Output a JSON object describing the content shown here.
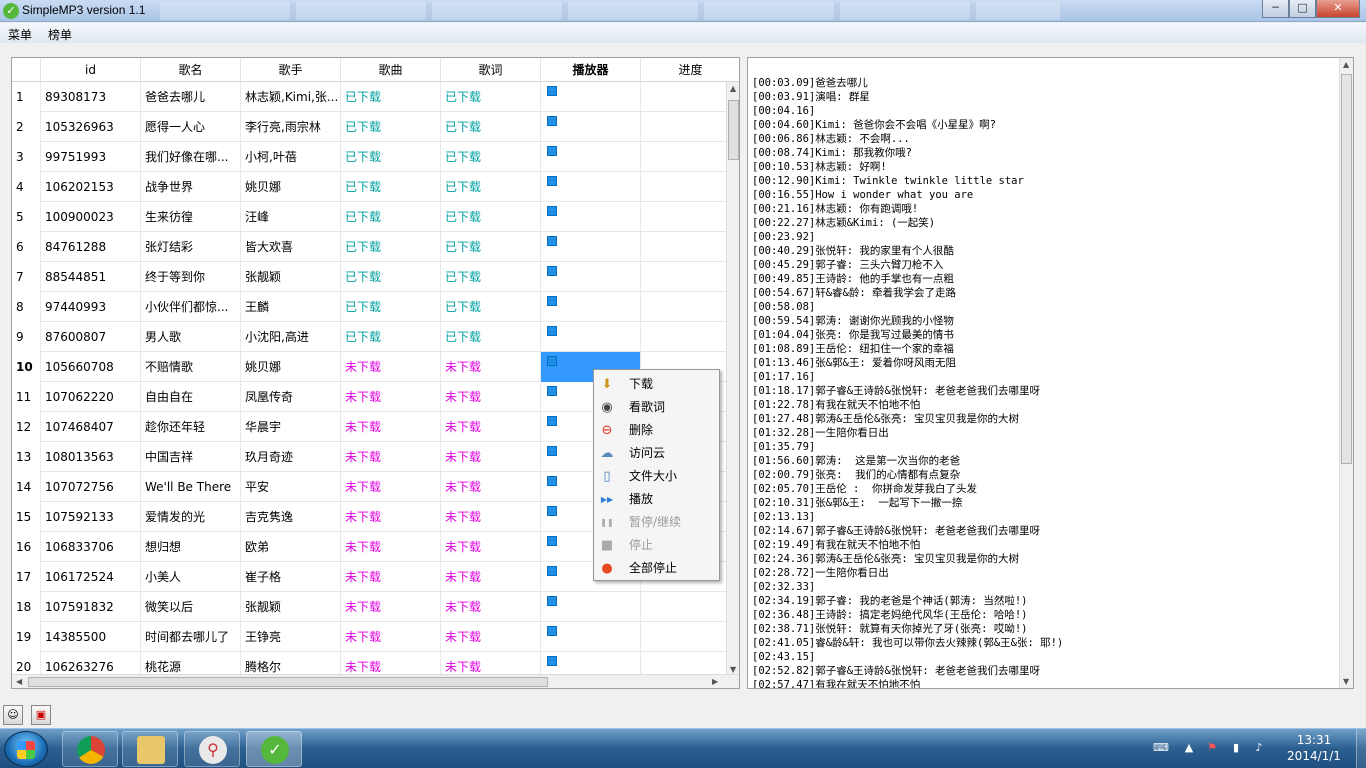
{
  "window": {
    "title": "SimpleMP3 version 1.1"
  },
  "menubar": {
    "items": [
      "菜单",
      "榜单"
    ]
  },
  "table": {
    "columns": [
      "id",
      "歌名",
      "歌手",
      "歌曲",
      "歌词",
      "播放器",
      "进度"
    ],
    "rows": [
      {
        "num": "1",
        "id": "89308173",
        "song": "爸爸去哪儿",
        "artist": "林志颖,Kimi,张...",
        "music": "已下载",
        "lyric": "已下载"
      },
      {
        "num": "2",
        "id": "105326963",
        "song": "愿得一人心",
        "artist": "李行亮,雨宗林",
        "music": "已下载",
        "lyric": "已下载"
      },
      {
        "num": "3",
        "id": "99751993",
        "song": "我们好像在哪...",
        "artist": "小柯,叶蓓",
        "music": "已下载",
        "lyric": "已下载"
      },
      {
        "num": "4",
        "id": "106202153",
        "song": "战争世界",
        "artist": "姚贝娜",
        "music": "已下载",
        "lyric": "已下载"
      },
      {
        "num": "5",
        "id": "100900023",
        "song": "生来彷徨",
        "artist": "汪峰",
        "music": "已下载",
        "lyric": "已下载"
      },
      {
        "num": "6",
        "id": "84761288",
        "song": "张灯结彩",
        "artist": "皆大欢喜",
        "music": "已下载",
        "lyric": "已下载"
      },
      {
        "num": "7",
        "id": "88544851",
        "song": "终于等到你",
        "artist": "张靓颖",
        "music": "已下载",
        "lyric": "已下载"
      },
      {
        "num": "8",
        "id": "97440993",
        "song": "小伙伴们都惊...",
        "artist": "王麟",
        "music": "已下载",
        "lyric": "已下载"
      },
      {
        "num": "9",
        "id": "87600807",
        "song": "男人歌",
        "artist": "小沈阳,高进",
        "music": "已下载",
        "lyric": "已下载"
      },
      {
        "num": "10",
        "id": "105660708",
        "song": "不赔情歌",
        "artist": "姚贝娜",
        "music": "未下载",
        "lyric": "未下载"
      },
      {
        "num": "11",
        "id": "107062220",
        "song": "自由自在",
        "artist": "凤凰传奇",
        "music": "未下载",
        "lyric": "未下载"
      },
      {
        "num": "12",
        "id": "107468407",
        "song": "趁你还年轻",
        "artist": "华晨宇",
        "music": "未下载",
        "lyric": "未下载"
      },
      {
        "num": "13",
        "id": "108013563",
        "song": "中国吉祥",
        "artist": "玖月奇迹",
        "music": "未下载",
        "lyric": "未下载"
      },
      {
        "num": "14",
        "id": "107072756",
        "song": "We'll Be There",
        "artist": "平安",
        "music": "未下载",
        "lyric": "未下载"
      },
      {
        "num": "15",
        "id": "107592133",
        "song": "爱情发的光",
        "artist": "吉克隽逸",
        "music": "未下载",
        "lyric": "未下载"
      },
      {
        "num": "16",
        "id": "106833706",
        "song": "想归想",
        "artist": "欧弟",
        "music": "未下载",
        "lyric": "未下载"
      },
      {
        "num": "17",
        "id": "106172524",
        "song": "小美人",
        "artist": "崔子格",
        "music": "未下载",
        "lyric": "未下载"
      },
      {
        "num": "18",
        "id": "107591832",
        "song": "微笑以后",
        "artist": "张靓颖",
        "music": "未下载",
        "lyric": "未下载"
      },
      {
        "num": "19",
        "id": "14385500",
        "song": "时间都去哪儿了",
        "artist": "王铮亮",
        "music": "未下载",
        "lyric": "未下载"
      },
      {
        "num": "20",
        "id": "106263276",
        "song": "桃花源",
        "artist": "腾格尔",
        "music": "未下载",
        "lyric": "未下载"
      }
    ],
    "selected_row": "10"
  },
  "context_menu": {
    "items": [
      {
        "label": "下载",
        "icon": "download-icon",
        "disabled": false
      },
      {
        "label": "看歌词",
        "icon": "eye-icon",
        "disabled": false
      },
      {
        "label": "删除",
        "icon": "delete-icon",
        "disabled": false
      },
      {
        "label": "访问云",
        "icon": "cloud-icon",
        "disabled": false
      },
      {
        "label": "文件大小",
        "icon": "clipboard-icon",
        "disabled": false
      },
      {
        "label": "播放",
        "icon": "play-icon",
        "disabled": false
      },
      {
        "label": "暂停/继续",
        "icon": "pause-icon",
        "disabled": true
      },
      {
        "label": "停止",
        "icon": "stop-icon",
        "disabled": true
      },
      {
        "label": "全部停止",
        "icon": "stop-all-icon",
        "disabled": false
      }
    ]
  },
  "lyrics": [
    "[00:03.09]爸爸去哪儿",
    "[00:03.91]演唱: 群星",
    "[00:04.16]",
    "[00:04.60]Kimi: 爸爸你会不会唱《小星星》啊?",
    "[00:06.86]林志颖: 不会啊...",
    "[00:08.74]Kimi: 那我教你哦?",
    "[00:10.53]林志颖: 好啊!",
    "[00:12.90]Kimi: Twinkle twinkle little star",
    "[00:16.55]How i wonder what you are",
    "[00:21.16]林志颖: 你有跑调哦!",
    "[00:22.27]林志颖&Kimi: (一起笑)",
    "[00:23.92]",
    "[00:40.29]张悦轩: 我的家里有个人很酷",
    "[00:45.29]郭子睿: 三头六臂刀枪不入",
    "[00:49.85]王诗龄: 他的手掌也有一点粗",
    "[00:54.67]轩&睿&龄: 牵着我学会了走路",
    "[00:58.08]",
    "[00:59.54]郭涛: 谢谢你光顾我的小怪物",
    "[01:04.04]张亮: 你是我写过最美的情书",
    "[01:08.89]王岳伦: 纽扣住一个家的幸福",
    "[01:13.46]张&郭&王: 爱着你呀风雨无阻",
    "[01:17.16]",
    "[01:18.17]郭子睿&王诗龄&张悦轩: 老爸老爸我们去哪里呀",
    "[01:22.78]有我在就天不怕地不怕",
    "[01:27.48]郭涛&王岳伦&张亮: 宝贝宝贝我是你的大树",
    "[01:32.28]一生陪你看日出",
    "[01:35.79]",
    "[01:56.60]郭涛:  这是第一次当你的老爸",
    "[02:00.79]张亮:  我们的心情都有点复杂",
    "[02:05.70]王岳伦 :  你拼命发芽我白了头发",
    "[02:10.31]张&郭&王:  一起写下一撇一捺",
    "[02:13.13]",
    "[02:14.67]郭子睿&王诗龄&张悦轩: 老爸老爸我们去哪里呀",
    "[02:19.49]有我在就天不怕地不怕",
    "[02:24.36]郭涛&王岳伦&张亮: 宝贝宝贝我是你的大树",
    "[02:28.72]一生陪你看日出",
    "[02:32.33]",
    "[02:34.19]郭子睿: 我的老爸是个神话(郭涛: 当然啦!)",
    "[02:36.48]王诗龄: 搞定老妈绝代风华(王岳伦: 哈哈!)",
    "[02:38.71]张悦轩: 就算有天你掉光了牙(张亮: 哎呦!)",
    "[02:41.05]睿&龄&轩: 我也可以带你去火辣辣(郭&王&张: 耶!)",
    "[02:43.15]",
    "[02:52.82]郭子睿&王诗龄&张悦轩: 老爸老爸我们去哪里呀",
    "[02:57.47]有我在就天不怕地不怕"
  ],
  "taskbar": {
    "apps": [
      "chrome",
      "explorer",
      "search-tool",
      "simplemp3"
    ],
    "clock_time": "13:31",
    "clock_date": "2014/1/1"
  }
}
